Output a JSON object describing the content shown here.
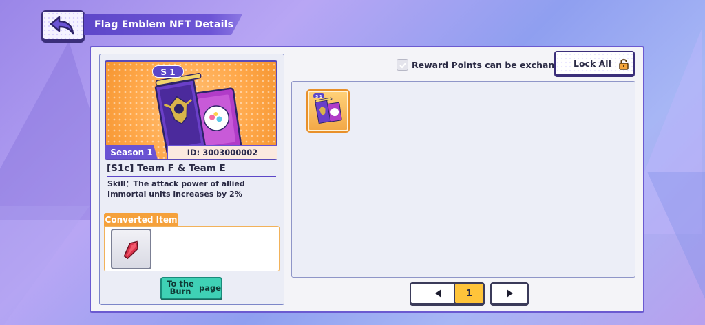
{
  "header": {
    "title": "Flag Emblem NFT Details",
    "back_icon": "back-arrow-icon"
  },
  "card": {
    "season_badge": "S 1",
    "season_label": "Season 1",
    "id_label": "ID: 3003000002",
    "name": "[S1c] Team F & Team E",
    "skill": "Skill：The attack power of allied Immortal units increases by 2%",
    "converted_title": "Converted Item",
    "converted_item_icon": "red-crystal-icon",
    "burn_button": "To the Burn page"
  },
  "controls": {
    "reward_checkbox_label": "Reward Points can be exchanged",
    "reward_checked": false,
    "lock_all_label": "Lock All",
    "lock_icon": "padlock-icon"
  },
  "inventory": {
    "items": [
      {
        "name": "flag-emblem-card",
        "badge": "S 1"
      }
    ]
  },
  "pagination": {
    "current_page": "1",
    "prev_icon": "triangle-left-icon",
    "next_icon": "triangle-right-icon"
  },
  "colors": {
    "accent": "#6a53d3",
    "orange": "#f5a13b",
    "teal": "#3fd1b5",
    "page_highlight": "#ffc43a"
  }
}
